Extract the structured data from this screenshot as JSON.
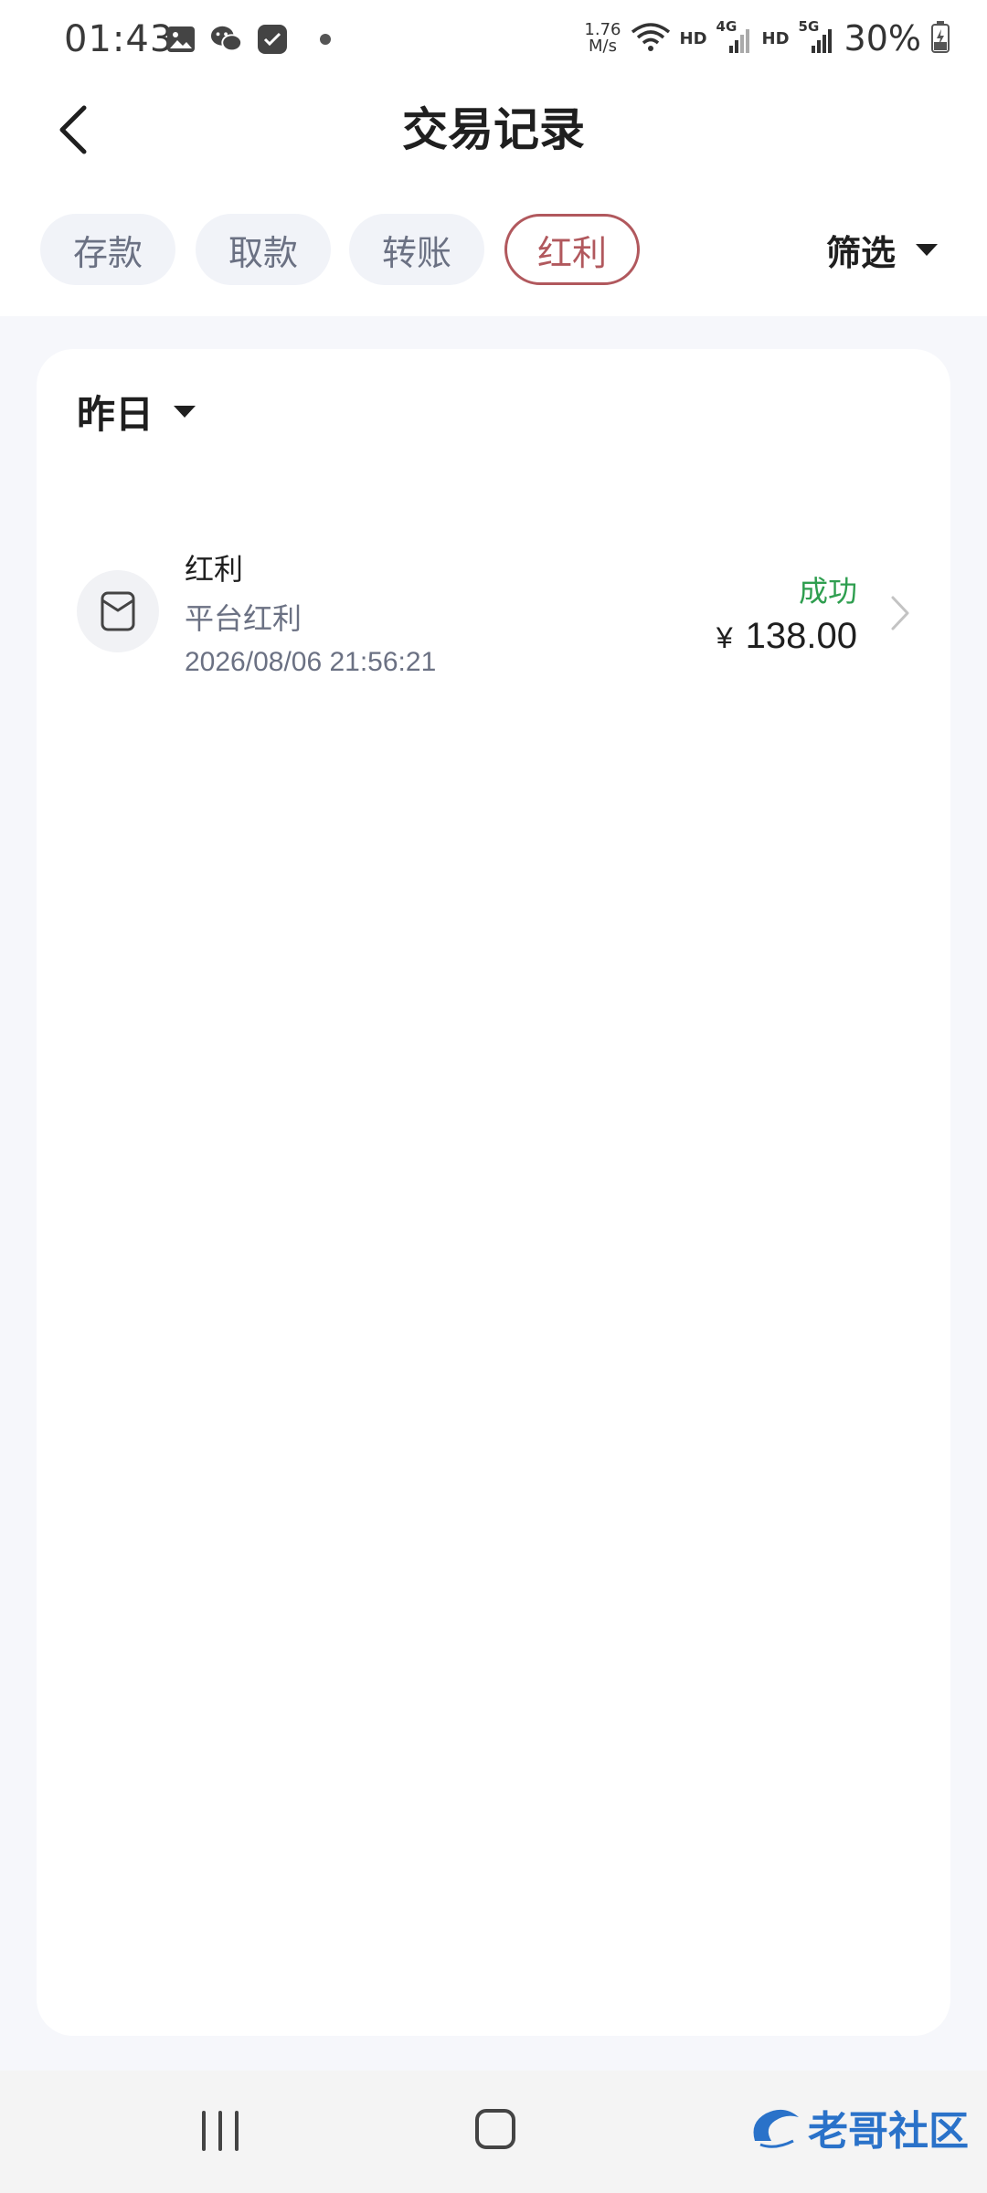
{
  "status_bar": {
    "time": "01:43",
    "net_speed_value": "1.76",
    "net_speed_unit": "M/s",
    "hd_label_1": "HD",
    "net_4g": "4G",
    "hd_label_2": "HD",
    "net_5g": "5G",
    "battery": "30%"
  },
  "header": {
    "title": "交易记录"
  },
  "tabs": [
    {
      "label": "存款",
      "active": false
    },
    {
      "label": "取款",
      "active": false
    },
    {
      "label": "转账",
      "active": false
    },
    {
      "label": "红利",
      "active": true
    }
  ],
  "filter": {
    "label": "筛选"
  },
  "date_filter": {
    "label": "昨日"
  },
  "transactions": [
    {
      "type": "红利",
      "description": "平台红利",
      "time": "2026/08/06 21:56:21",
      "status": "成功",
      "currency": "¥",
      "amount": "138.00"
    }
  ],
  "colors": {
    "accent": "#b1585d",
    "success": "#2e9e4f",
    "page_bg": "#f6f7fb",
    "tab_bg": "#f1f3f8",
    "text_secondary": "#6b7183"
  },
  "watermark": {
    "text": "老哥社区"
  }
}
